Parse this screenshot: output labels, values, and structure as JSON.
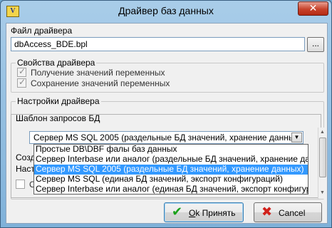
{
  "window": {
    "title": "Драйвер баз данных",
    "app_icon_text": "V",
    "close_symbol": "✕"
  },
  "driver_file": {
    "label": "Файл драйвера",
    "value": "dbAccess_BDE.bpl",
    "browse_label": "..."
  },
  "driver_properties": {
    "title": "Свойства драйвера",
    "options": [
      {
        "label": "Получение значений переменных",
        "checked": true
      },
      {
        "label": "Сохранение значений переменных",
        "checked": true
      }
    ]
  },
  "driver_settings": {
    "title": "Настройки драйвера",
    "query_template_label": "Шаблон запросов БД",
    "combo_value": "Сервер MS SQL 2005 (раздельные БД значений, хранение данных)",
    "hidden_labels": [
      "Созд",
      "Наст",
      "Со"
    ],
    "options": [
      "Простые DB\\DBF фалы баз данных",
      "Сервер Interbase или аналог (раздельные БД значений, хранение данных)",
      "Сервер MS SQL 2005 (раздельные БД значений, хранение данных)",
      "Сервер MS SQL (единая БД значений, экспорт конфигураций)",
      "Сервер Interbase или аналог (единая БД значений, экспорт конфигураций)"
    ],
    "selected_index": 2
  },
  "buttons": {
    "ok": {
      "hotkey": "О",
      "rest": "k Принять",
      "icon": "✔",
      "icon_color": "#1aa11a"
    },
    "cancel": {
      "label": "Cancel",
      "icon": "✖",
      "icon_color": "#d0211b"
    }
  }
}
